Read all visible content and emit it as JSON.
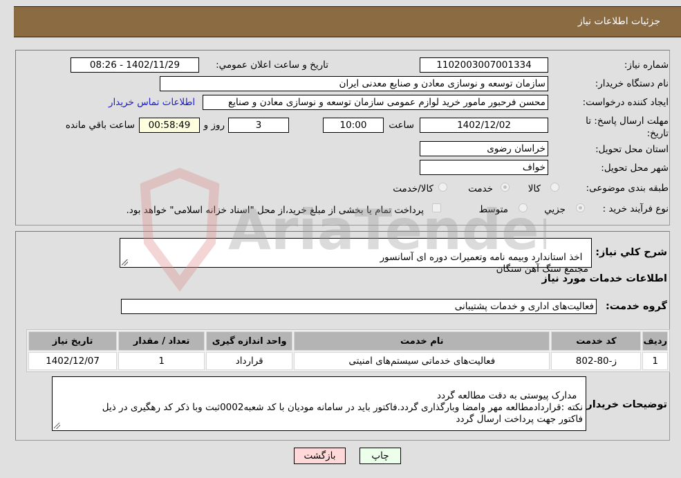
{
  "header": {
    "title": "جزئیات اطلاعات نیاز"
  },
  "form": {
    "need_number": {
      "label": "شماره نیاز:",
      "value": "1102003007001334"
    },
    "announce_datetime": {
      "label": "تاريخ و ساعت اعلان عمومي:",
      "value": "1402/11/29 - 08:26"
    },
    "buyer_org": {
      "label": "نام دستگاه خریدار:",
      "value": "سازمان توسعه و نوسازی معادن و صنایع معدنی ایران"
    },
    "requester": {
      "label": "ایجاد کننده درخواست:",
      "value": "محسن فرحبور مامور خرید لوازم عمومی سازمان توسعه و نوسازی معادن و صنایع",
      "contact_link": "اطلاعات تماس خریدار"
    },
    "deadline": {
      "label": "مهلت ارسال پاسخ: تا تاریخ:",
      "date": "1402/12/02",
      "time_label": "ساعت",
      "time": "10:00",
      "days": "3",
      "days_label": "روز و",
      "remaining": "00:58:49",
      "remaining_label": "ساعت باقي مانده"
    },
    "province": {
      "label": "استان محل تحویل:",
      "value": "خراسان رضوی"
    },
    "city": {
      "label": "شهر محل تحویل:",
      "value": "خواف"
    },
    "category": {
      "label": "طبقه بندی موضوعی:",
      "options": [
        "کالا",
        "خدمت",
        "کالا/خدمت"
      ],
      "selected": "خدمت"
    },
    "purchase_type": {
      "label": "نوع فرآیند خرید :",
      "options": [
        "جزيي",
        "متوسط"
      ],
      "selected": "جزيي",
      "treasury_note": "پرداخت تمام یا بخشی از مبلغ خرید،از محل \"اسناد خزانه اسلامی\" خواهد بود."
    }
  },
  "details": {
    "description_label": "شرح کلي نياز:",
    "description": "اخذ استاندارد وبیمه نامه وتعمیرات دوره ای آسانسور\nمجتمع سنگ آهن سنگان",
    "services_heading": "اطلاعات خدمات مورد نیاز",
    "service_group_label": "گروه خدمت:",
    "service_group": "فعالیت‌های اداری و خدمات پشتیبانی",
    "table": {
      "headers": [
        "ردیف",
        "کد خدمت",
        "نام خدمت",
        "واحد اندازه گیری",
        "تعداد / مقدار",
        "تاریخ نیاز"
      ],
      "rows": [
        [
          "1",
          "ز-80-802",
          "فعالیت‌های خدماتی سیستم‌های امنیتی",
          "قرارداد",
          "1",
          "1402/12/07"
        ]
      ]
    },
    "buyer_notes_label": "توضیحات خریدار:",
    "buyer_notes": "مدارک پیوستی به دقت مطالعه گردد\nنکته :قراردادمطالعه مهر وامضا وبارگذاری گردد.فاکتور باید در سامانه مودیان با کد شعبه0002ثبت وبا ذکر کد رهگیری در ذیل\nفاکتور جهت پرداخت ارسال گردد"
  },
  "buttons": {
    "print": "چاپ",
    "back": "بازگشت"
  },
  "watermark": {
    "text": "AriaTender.neT"
  }
}
